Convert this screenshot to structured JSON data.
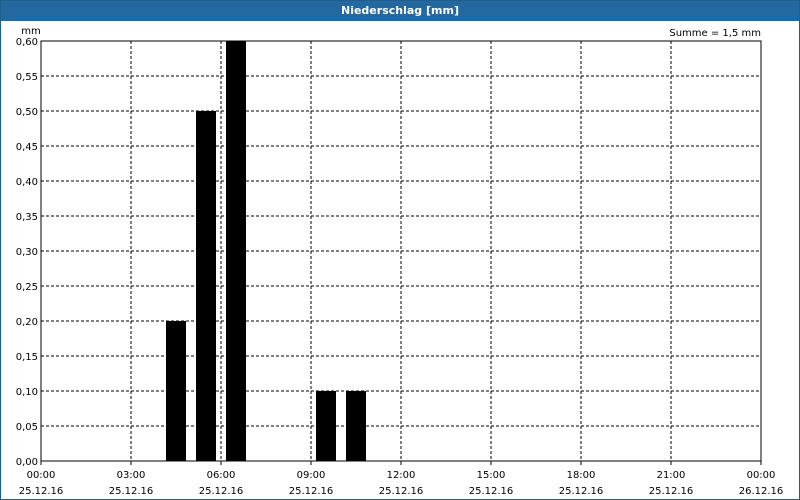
{
  "window": {
    "title": "Niederschlag [mm]"
  },
  "chart_data": {
    "type": "bar",
    "title": "Niederschlag [mm]",
    "ylabel": "mm",
    "xlabel": "",
    "annotation": "Summe = 1,5 mm",
    "ylim": [
      0,
      0.6
    ],
    "xlim_hours": [
      0,
      24
    ],
    "grid": true,
    "y_ticks": [
      "0,00",
      "0,05",
      "0,10",
      "0,15",
      "0,20",
      "0,25",
      "0,30",
      "0,35",
      "0,40",
      "0,45",
      "0,50",
      "0,55",
      "0,60"
    ],
    "x_ticks": [
      {
        "time": "00:00",
        "date": "25.12.16"
      },
      {
        "time": "03:00",
        "date": "25.12.16"
      },
      {
        "time": "06:00",
        "date": "25.12.16"
      },
      {
        "time": "09:00",
        "date": "25.12.16"
      },
      {
        "time": "12:00",
        "date": "25.12.16"
      },
      {
        "time": "15:00",
        "date": "25.12.16"
      },
      {
        "time": "18:00",
        "date": "25.12.16"
      },
      {
        "time": "21:00",
        "date": "25.12.16"
      },
      {
        "time": "00:00",
        "date": "26.12.16"
      }
    ],
    "bars": [
      {
        "x": "04:30",
        "value": 0.2
      },
      {
        "x": "05:30",
        "value": 0.5
      },
      {
        "x": "06:30",
        "value": 0.6
      },
      {
        "x": "09:30",
        "value": 0.1
      },
      {
        "x": "10:30",
        "value": 0.1
      }
    ],
    "bar_color": "#000000",
    "grid_color": "#000000",
    "title_bar_color": "#2468a0"
  }
}
